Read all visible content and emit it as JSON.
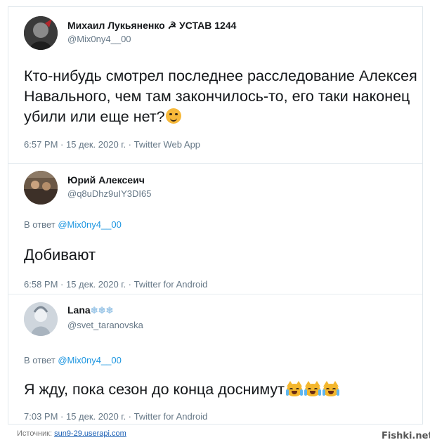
{
  "tweets": [
    {
      "name": "Михаил Лукьяненко ☭ УСТАВ 1244",
      "handle": "@Mix0ny4__00",
      "text": "Кто-нибудь смотрел последнее расследование Алексея Навального, чем там закончилось-то, его таки наконец убили или еще нет?",
      "emoji": "thinking-face-icon",
      "meta": "6:57 PM · 15 дек. 2020 г. · Twitter Web App"
    },
    {
      "name": "Юрий Алексеич",
      "handle": "@q8uDhz9uIY3DI65",
      "reply_prefix": "В ответ",
      "reply_to": "@Mix0ny4__00",
      "text": "Добивают",
      "meta": "6:58 PM · 15 дек. 2020 г. · Twitter for Android"
    },
    {
      "name": "Lana",
      "name_suffix": "❄❄❄",
      "handle": "@svet_taranovska",
      "reply_prefix": "В ответ",
      "reply_to": "@Mix0ny4__00",
      "text": "Я жду, пока сезон до конца доснимут",
      "emoji": "crying-laughing-cat-icon",
      "meta": "7:03 PM · 15 дек. 2020 г. · Twitter for Android"
    }
  ],
  "footer": {
    "source_label": "Источник:",
    "source_link": "sun9-29.userapi.com",
    "watermark": "Fishki.net"
  }
}
